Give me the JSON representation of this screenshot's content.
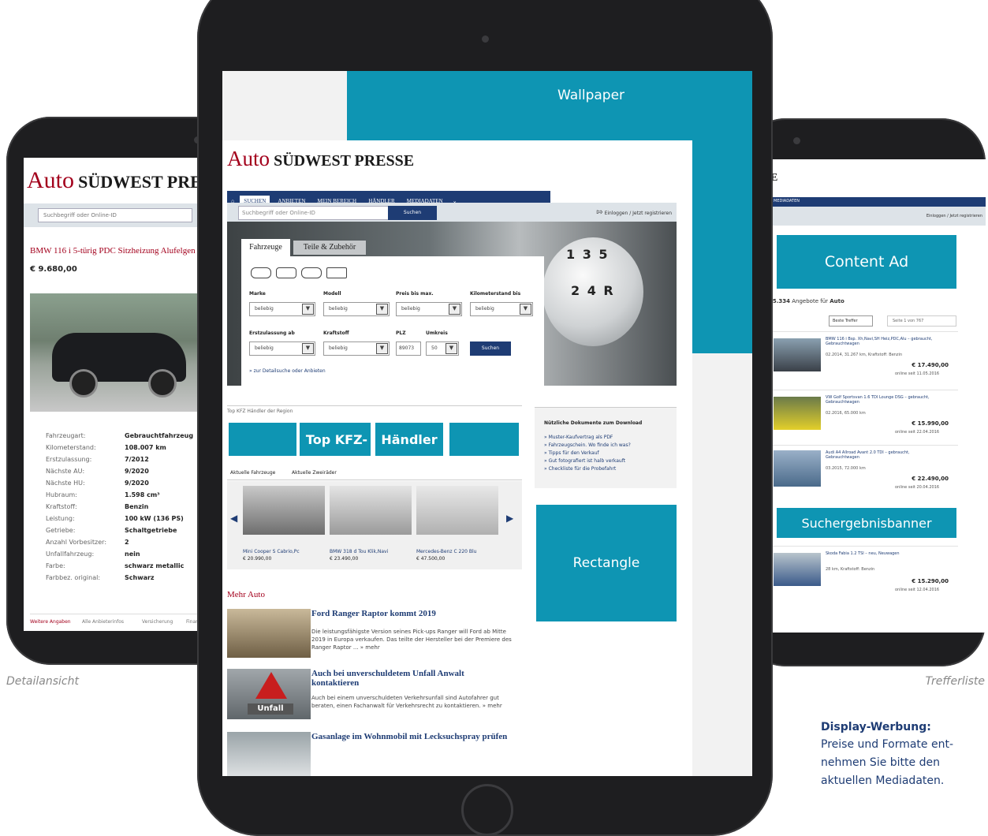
{
  "captions": {
    "left": "Detailansicht",
    "right": "Trefferliste",
    "info_title": "Display-Werbung:",
    "info_line1": "Preise und Formate ent-",
    "info_line2": "nehmen Sie bitte den",
    "info_line3": "aktuellen Mediadaten."
  },
  "brand": {
    "auto": "Auto",
    "paper": "SÜDWEST PRESSE",
    "short_e": "E"
  },
  "ads": {
    "wallpaper": "Wallpaper",
    "top_dealer_a": "Top KFZ-",
    "top_dealer_b": "Händler",
    "rectangle": "Rectangle",
    "content_ad": "Content Ad",
    "search_banner": "Suchergebnisbanner"
  },
  "left_screen": {
    "search_placeholder": "Suchbegriff oder Online-ID",
    "car_title": "BMW 116 i 5-türig PDC Sitzheizung Alufelgen",
    "price": "€ 9.680,00",
    "specs": [
      {
        "label": "Fahrzeugart:",
        "value": "Gebrauchtfahrzeug"
      },
      {
        "label": "Kilometerstand:",
        "value": "108.007 km"
      },
      {
        "label": "Erstzulassung:",
        "value": "7/2012"
      },
      {
        "label": "Nächste AU:",
        "value": "9/2020"
      },
      {
        "label": "Nächste HU:",
        "value": "9/2020"
      },
      {
        "label": "Hubraum:",
        "value": "1.598 cm³"
      },
      {
        "label": "Kraftstoff:",
        "value": "Benzin"
      },
      {
        "label": "Leistung:",
        "value": "100 kW (136 PS)"
      },
      {
        "label": "Getriebe:",
        "value": "Schaltgetriebe"
      },
      {
        "label": "Anzahl Vorbesitzer:",
        "value": "2"
      },
      {
        "label": "Unfallfahrzeug:",
        "value": "nein"
      },
      {
        "label": "Farbe:",
        "value": "schwarz metallic"
      },
      {
        "label": "Farbbez. original:",
        "value": "Schwarz"
      }
    ],
    "tabs": [
      "Weitere Angaben",
      "Alle Anbieterinfos",
      "Versicherung",
      "Finanz"
    ]
  },
  "center_screen": {
    "nav": [
      "SUCHEN",
      "ANBIETEN",
      "MEIN BEREICH",
      "HÄNDLER",
      "MEDIADATEN"
    ],
    "search_placeholder": "Suchbegriff oder Online-ID",
    "search_button": "Suchen",
    "login": "Einloggen",
    "register": "Jetzt registrieren",
    "tab_vehicles": "Fahrzeuge",
    "tab_parts": "Teile & Zubehör",
    "labels": {
      "marke": "Marke",
      "modell": "Modell",
      "preis": "Preis bis max.",
      "km": "Kilometerstand bis",
      "ez": "Erstzulassung ab",
      "kraftstoff": "Kraftstoff",
      "plz": "PLZ",
      "umkreis": "Umkreis"
    },
    "select_value": "beliebig",
    "plz_value": "89073",
    "umkreis_value": "50",
    "form_search_button": "Suchen",
    "detail_link": "» zur Detailsuche oder Anbieten",
    "gear_top": "1 3 5",
    "gear_bottom": "2 4 R",
    "dealer_heading": "Top KFZ Händler der Region",
    "car_tabs": [
      "Aktuelle Fahrzeuge",
      "Aktuelle Zweiräder"
    ],
    "cars": [
      {
        "name": "Mini Cooper S Cabrio,Pc",
        "price": "€ 20.990,00"
      },
      {
        "name": "BMW 318 d Tou Klik,Navi",
        "price": "€ 23.490,00"
      },
      {
        "name": "Mercedes-Benz C 220 Blu",
        "price": "€ 47.500,00"
      }
    ],
    "downloads_title": "Nützliche Dokumente zum Download",
    "downloads": [
      "» Muster-Kaufvertrag als PDF",
      "» Fahrzeugschein. Wo finde ich was?",
      "» Tipps für den Verkauf",
      "» Gut fotografiert ist halb verkauft",
      "» Checkliste für die Probefahrt"
    ],
    "more_heading": "Mehr Auto",
    "news": [
      {
        "title": "Ford Ranger Raptor kommt 2019",
        "text": "Die leistungsfähigste Version seines Pick-ups Ranger will Ford ab Mitte 2019 in Europa verkaufen. Das teilte der Hersteller bei der Premiere des Ranger Raptor ... » mehr"
      },
      {
        "title": "Auch bei unverschuldetem Unfall Anwalt kontaktieren",
        "text": "Auch bei einem unverschuldeten Verkehrsunfall sind Autofahrer gut beraten, einen Fachanwalt für Verkehrsrecht zu kontaktieren. » mehr"
      },
      {
        "title": "Gasanlage im Wohnmobil mit Lecksuchspray prüfen",
        "text": ""
      }
    ],
    "unfall_sign": "Unfall"
  },
  "right_screen": {
    "nav_partial": "MEDIADATEN",
    "login": "Einloggen / Jetzt registrieren",
    "count": "15.334",
    "count_text": "Angebote für",
    "count_brand": "Auto",
    "sort": "Beste Treffer",
    "page": "Seite 1 von 767",
    "results": [
      {
        "title": "BMW 116 i Bsp. Xh,Navi,SH Heiz,PDC,Alu – gebraucht, Gebrauchtwagen",
        "meta": "02.2014, 31.267 km, Kraftstoff: Benzin",
        "price": "€ 17.490,00",
        "date": "online seit 11.05.2016"
      },
      {
        "title": "VW Golf Sportsvan 1.6 TDI Lounge DSG – gebraucht, Gebrauchtwagen",
        "meta": "02.2016, 65.000 km",
        "price": "€ 15.990,00",
        "date": "online seit 22.04.2016"
      },
      {
        "title": "Audi A4 Allroad Avant 2.0 TDI – gebraucht, Gebrauchtwagen",
        "meta": "03.2015, 72.000 km",
        "price": "€ 22.490,00",
        "date": "online seit 20.04.2016"
      },
      {
        "title": "Skoda Fabia 1.2 TSI – neu, Neuwagen",
        "meta": "28 km, Kraftstoff: Benzin",
        "price": "€ 15.290,00",
        "date": "online seit 12.04.2016"
      }
    ]
  }
}
